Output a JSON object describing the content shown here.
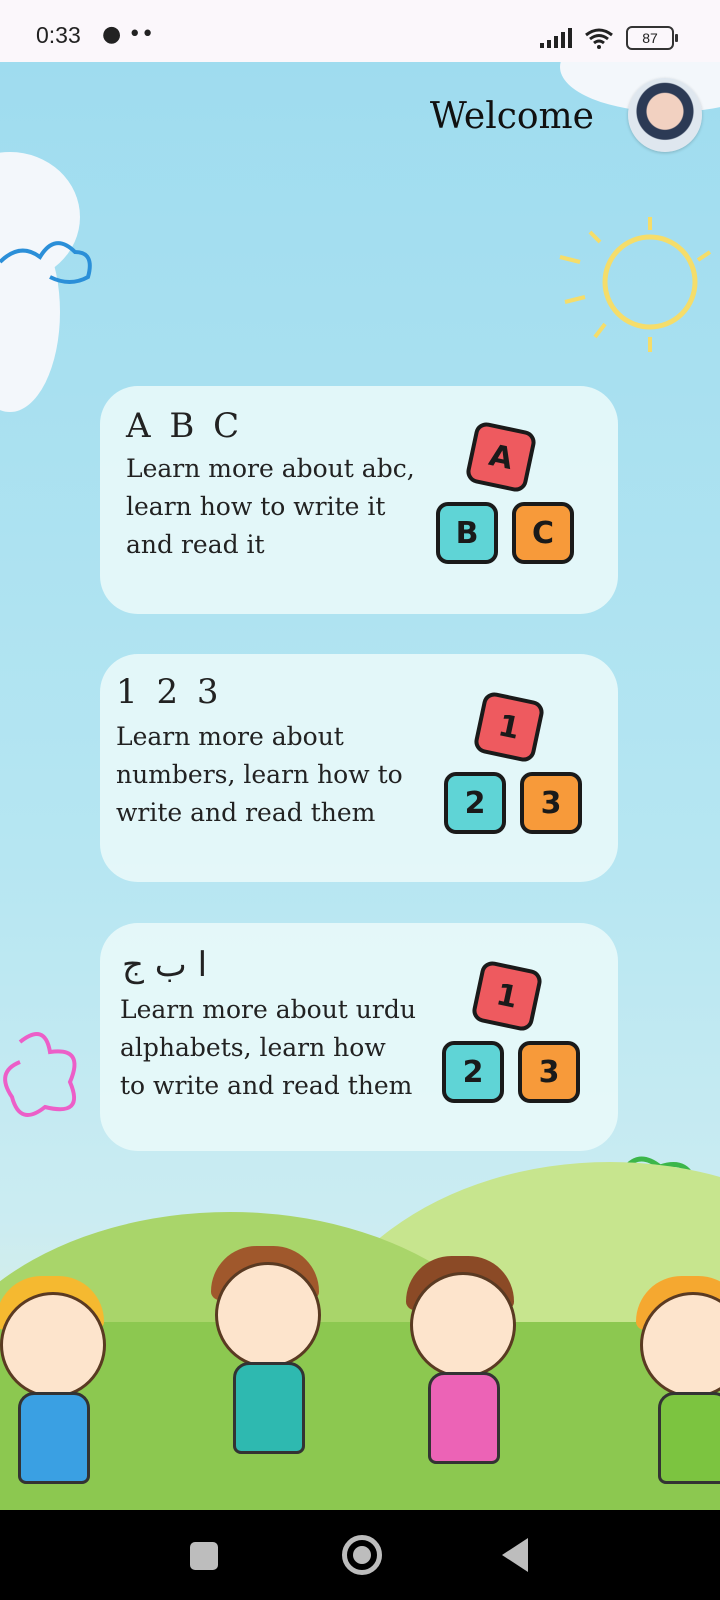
{
  "status_bar": {
    "time": "0:33",
    "left_icons": "••",
    "battery": "87"
  },
  "header": {
    "welcome": "Welcome"
  },
  "cards": [
    {
      "title": "A B C",
      "description": "Learn more about abc,\n learn how to write it\n and read it",
      "blocks": [
        "A",
        "B",
        "C"
      ]
    },
    {
      "title": "1 2 3",
      "description": "Learn more about\n numbers,  learn how to\n write and read them",
      "blocks": [
        "1",
        "2",
        "3"
      ]
    },
    {
      "title": "ا ب ج",
      "description": "Learn more about urdu\nalphabets,  learn how\nto write and read them",
      "blocks": [
        "1",
        "2",
        "3"
      ]
    }
  ],
  "colors": {
    "block_red": "#ee5a5f",
    "block_cyan": "#5fd4d6",
    "block_orange": "#f79a3a",
    "sky": "#9fdcef"
  }
}
